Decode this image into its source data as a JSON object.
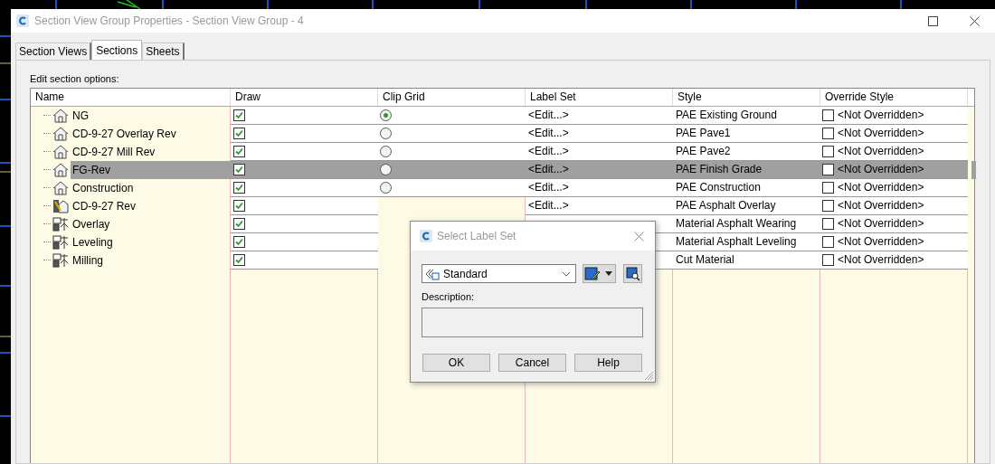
{
  "window": {
    "title": "Section View Group Properties - Section View Group - 4"
  },
  "tabs": [
    {
      "label": "Section Views",
      "selected": false
    },
    {
      "label": "Sections",
      "selected": true
    },
    {
      "label": "Sheets",
      "selected": false
    }
  ],
  "caption": "Edit section options:",
  "table": {
    "columns": [
      "Name",
      "Draw",
      "Clip Grid",
      "Label Set",
      "Style",
      "Override Style"
    ],
    "rows": [
      {
        "kind": "section",
        "name": "NG",
        "draw": true,
        "clip_grid": {
          "selected": true
        },
        "label_set": "<Edit...>",
        "style": "PAE Existing Ground",
        "override": {
          "checked": false,
          "text": "<Not Overridden>"
        },
        "selected": false
      },
      {
        "kind": "section",
        "name": "CD-9-27 Overlay Rev",
        "draw": true,
        "clip_grid": {
          "selected": false
        },
        "label_set": "<Edit...>",
        "style": "PAE Pave1",
        "override": {
          "checked": false,
          "text": "<Not Overridden>"
        },
        "selected": false
      },
      {
        "kind": "section",
        "name": "CD-9-27 Mill Rev",
        "draw": true,
        "clip_grid": {
          "selected": false
        },
        "label_set": "<Edit...>",
        "style": "PAE Pave2",
        "override": {
          "checked": false,
          "text": "<Not Overridden>"
        },
        "selected": false
      },
      {
        "kind": "section",
        "name": "FG-Rev",
        "draw": true,
        "clip_grid": {
          "selected": false
        },
        "label_set": "<Edit...>",
        "style": "PAE Finish Grade",
        "override": {
          "checked": false,
          "text": "<Not Overridden>"
        },
        "selected": true
      },
      {
        "kind": "section",
        "name": "Construction",
        "draw": true,
        "clip_grid": {
          "selected": false
        },
        "label_set": "<Edit...>",
        "style": "PAE Construction",
        "override": {
          "checked": false,
          "text": "<Not Overridden>"
        },
        "selected": false
      },
      {
        "kind": "corridor",
        "name": "CD-9-27 Rev",
        "draw": true,
        "label_set": "<Edit...>",
        "style": "PAE Asphalt Overlay",
        "override": {
          "checked": false,
          "text": "<Not Overridden>"
        },
        "selected": false
      },
      {
        "kind": "material",
        "name": "Overlay",
        "draw": true,
        "style": "Material Asphalt Wearing",
        "override": {
          "checked": false,
          "text": "<Not Overridden>"
        },
        "selected": false
      },
      {
        "kind": "material",
        "name": "Leveling",
        "draw": true,
        "style": "Material Asphalt Leveling",
        "override": {
          "checked": false,
          "text": "<Not Overridden>"
        },
        "selected": false
      },
      {
        "kind": "material",
        "name": "Milling",
        "draw": true,
        "style": "Cut Material",
        "override": {
          "checked": false,
          "text": "<Not Overridden>"
        },
        "selected": false
      }
    ]
  },
  "dialog": {
    "title": "Select Label Set",
    "combo_value": "Standard",
    "description_label": "Description:",
    "buttons": [
      "OK",
      "Cancel",
      "Help"
    ]
  }
}
